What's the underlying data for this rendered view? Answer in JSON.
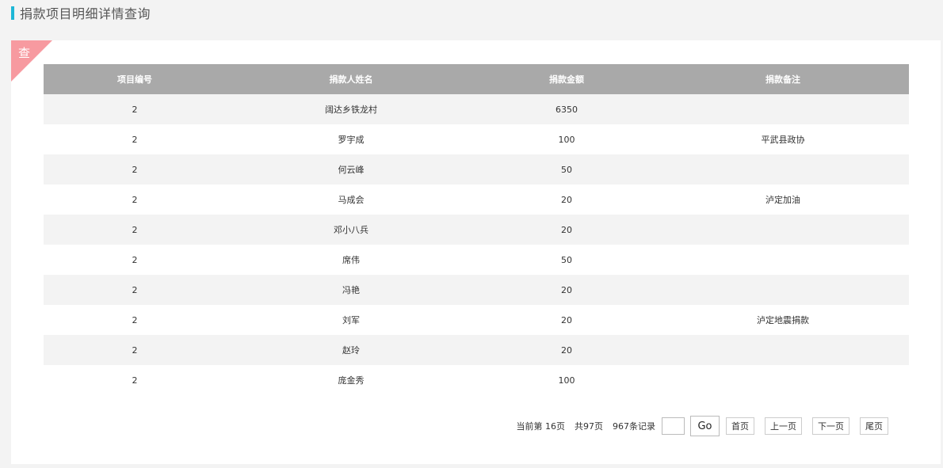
{
  "page_title": "捐款项目明细详情查询",
  "corner_label": "查",
  "table": {
    "headers": [
      "项目编号",
      "捐款人姓名",
      "捐款金额",
      "捐款备注"
    ],
    "rows": [
      [
        "2",
        "阔达乡铁龙村",
        "6350",
        ""
      ],
      [
        "2",
        "罗宇成",
        "100",
        "平武县政协"
      ],
      [
        "2",
        "何云峰",
        "50",
        ""
      ],
      [
        "2",
        "马成会",
        "20",
        "泸定加油"
      ],
      [
        "2",
        "邓小八兵",
        "20",
        ""
      ],
      [
        "2",
        "席伟",
        "50",
        ""
      ],
      [
        "2",
        "冯艳",
        "20",
        ""
      ],
      [
        "2",
        "刘军",
        "20",
        "泸定地震捐款"
      ],
      [
        "2",
        "赵玲",
        "20",
        ""
      ],
      [
        "2",
        "庞金秀",
        "100",
        ""
      ]
    ]
  },
  "pager": {
    "current_page": "当前第 16页",
    "total_pages": "共97页",
    "total_records": "967条记录",
    "page_input_value": "",
    "go_label": "Go",
    "first_label": "首页",
    "prev_label": "上一页",
    "next_label": "下一页",
    "last_label": "尾页"
  }
}
